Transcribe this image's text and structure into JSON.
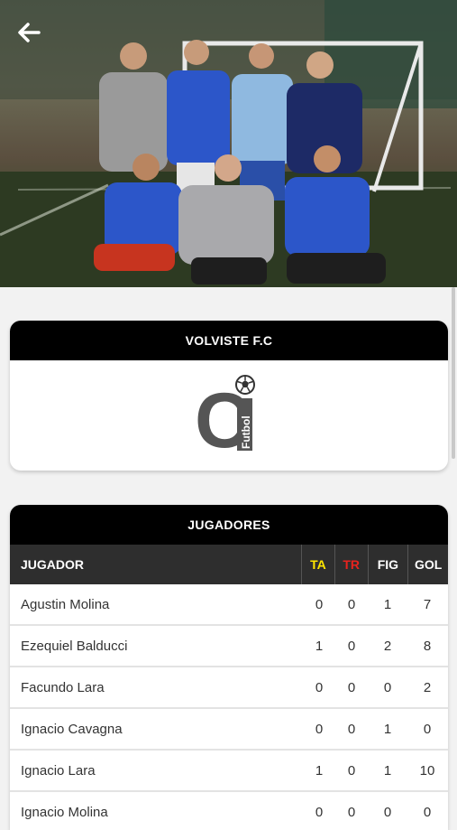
{
  "team": {
    "name": "VOLVISTE F.C",
    "logo": {
      "letter": "C",
      "text": "Futbol"
    }
  },
  "players_section": {
    "title": "JUGADORES",
    "headers": {
      "player": "JUGADOR",
      "ta": "TA",
      "tr": "TR",
      "fig": "FIG",
      "gol": "GOL"
    },
    "rows": [
      {
        "name": "Agustin Molina",
        "ta": "0",
        "tr": "0",
        "fig": "1",
        "gol": "7"
      },
      {
        "name": "Ezequiel Balducci",
        "ta": "1",
        "tr": "0",
        "fig": "2",
        "gol": "8"
      },
      {
        "name": "Facundo Lara",
        "ta": "0",
        "tr": "0",
        "fig": "0",
        "gol": "2"
      },
      {
        "name": "Ignacio Cavagna",
        "ta": "0",
        "tr": "0",
        "fig": "1",
        "gol": "0"
      },
      {
        "name": "Ignacio Lara",
        "ta": "1",
        "tr": "0",
        "fig": "1",
        "gol": "10"
      },
      {
        "name": "Ignacio Molina",
        "ta": "0",
        "tr": "0",
        "fig": "0",
        "gol": "0"
      }
    ]
  },
  "colors": {
    "yellow_card": "#ffe600",
    "red_card": "#e8231e",
    "header_black": "#000000",
    "table_header": "#2e2e2e"
  },
  "icons": {
    "back": "arrow-left-icon",
    "ball": "soccer-ball-icon"
  }
}
